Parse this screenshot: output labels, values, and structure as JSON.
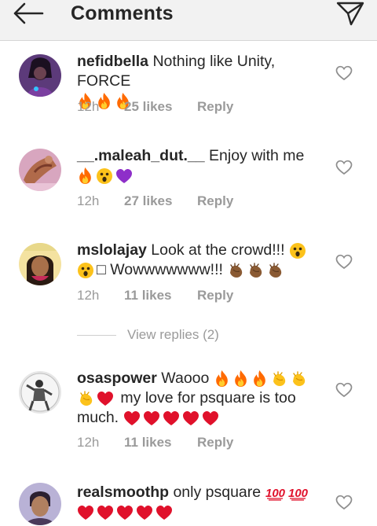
{
  "header": {
    "title": "Comments",
    "back_icon": "arrow-left-icon",
    "send_icon": "paper-plane-icon"
  },
  "comments": [
    {
      "username": "nefidbella",
      "text": " Nothing like Unity, FORCE",
      "emojis": [
        "fire",
        "fire",
        "fire"
      ],
      "time": "12h",
      "likes": "25 likes",
      "reply": "Reply"
    },
    {
      "username": "__.maleah_dut.__",
      "text": " Enjoy with me",
      "emojis": [
        "fire",
        "astonished-face",
        "purple-heart"
      ],
      "time": "12h",
      "likes": "27 likes",
      "reply": "Reply"
    },
    {
      "username": "mslolajay",
      "text": " Look at the crowd!!! ",
      "line2_prefix": "□ Wowwwwwww!!! ",
      "emojis": [
        "astonished-face",
        "astonished-face",
        "clapping-hands",
        "clapping-hands",
        "clapping-hands"
      ],
      "time": "12h",
      "likes": "11 likes",
      "reply": "Reply",
      "view_replies": "View replies (2)"
    },
    {
      "username": "osaspower",
      "text": " Waooo ",
      "line2_text": " my love for psquare is too",
      "line3_text": "much. ",
      "emojis": [
        "fire",
        "fire",
        "fire",
        "clapping-hands",
        "clapping-hands",
        "clapping-hands",
        "red-heart",
        "red-heart",
        "red-heart",
        "red-heart",
        "red-heart",
        "red-heart"
      ],
      "time": "12h",
      "likes": "11 likes",
      "reply": "Reply"
    },
    {
      "username": "realsmoothp",
      "text": " only psquare ",
      "emojis": [
        "hundred-points",
        "hundred-points",
        "red-heart",
        "red-heart",
        "red-heart",
        "red-heart",
        "red-heart"
      ]
    }
  ],
  "icons": {
    "like": "heart-outline-icon"
  },
  "colors": {
    "text": "#262626",
    "meta": "#9a9a9a",
    "header_bg": "#f2f2f2",
    "fire": "#ff6a00",
    "heart_red": "#e0112b",
    "purple": "#8e2fc9"
  }
}
